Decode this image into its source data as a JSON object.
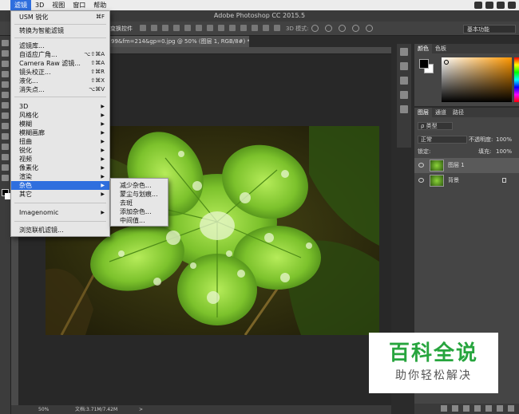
{
  "menubar": {
    "items": [
      {
        "label": "滤镜",
        "active": true
      },
      {
        "label": "3D"
      },
      {
        "label": "视图"
      },
      {
        "label": "窗口"
      },
      {
        "label": "帮助"
      }
    ]
  },
  "app": {
    "title": "Adobe Photoshop CC 2015.5"
  },
  "options": {
    "show_transform_label": "变换控件",
    "mode_3d_label": "3D 模式:",
    "workspace": "基本功能"
  },
  "document": {
    "tab_title": "99&fm=214&gp=0.jpg @ 50% (图层 1, RGB/8#) *"
  },
  "status": {
    "zoom": "50%",
    "doc_size": "文档:3.71M/7.42M",
    "arrow": ">"
  },
  "filter_menu": {
    "items": [
      {
        "label": "USM 锐化",
        "shortcut": "⌘F"
      },
      {
        "label": "转换为智能滤镜"
      },
      {
        "label": "滤镜库..."
      },
      {
        "label": "自适应广角...",
        "shortcut": "⌥⇧⌘A"
      },
      {
        "label": "Camera Raw 滤镜...",
        "shortcut": "⇧⌘A"
      },
      {
        "label": "镜头校正...",
        "shortcut": "⇧⌘R"
      },
      {
        "label": "液化...",
        "shortcut": "⇧⌘X"
      },
      {
        "label": "消失点...",
        "shortcut": "⌥⌘V"
      },
      {
        "label": "3D",
        "submenu": true
      },
      {
        "label": "风格化",
        "submenu": true
      },
      {
        "label": "模糊",
        "submenu": true
      },
      {
        "label": "模糊画廊",
        "submenu": true
      },
      {
        "label": "扭曲",
        "submenu": true
      },
      {
        "label": "锐化",
        "submenu": true
      },
      {
        "label": "视频",
        "submenu": true
      },
      {
        "label": "像素化",
        "submenu": true
      },
      {
        "label": "渲染",
        "submenu": true
      },
      {
        "label": "杂色",
        "submenu": true,
        "highlighted": true
      },
      {
        "label": "其它",
        "submenu": true
      },
      {
        "label": "Imagenomic",
        "submenu": true
      },
      {
        "label": "浏览联机滤镜..."
      }
    ],
    "arrow_glyph": "▶"
  },
  "noise_submenu": {
    "items": [
      {
        "label": "减少杂色..."
      },
      {
        "label": "蒙尘与划痕..."
      },
      {
        "label": "去斑"
      },
      {
        "label": "添加杂色..."
      },
      {
        "label": "中间值..."
      }
    ]
  },
  "color_panel": {
    "tabs": [
      "颜色",
      "色板"
    ],
    "fg": "#000000",
    "bg": "#ffffff"
  },
  "layers_panel": {
    "tabs": [
      "图层",
      "通道",
      "路径"
    ],
    "filter_kind": "ρ 类型",
    "blend_mode": "正常",
    "opacity_label": "不透明度:",
    "opacity": "100%",
    "lock_label": "锁定:",
    "fill_label": "填充:",
    "fill": "100%",
    "layers": [
      {
        "name": "图层 1",
        "selected": true
      },
      {
        "name": "背景",
        "locked": true
      }
    ]
  },
  "watermark": {
    "title": "百科全说",
    "subtitle": "助你轻松解决",
    "title_color": "#27a53e"
  }
}
